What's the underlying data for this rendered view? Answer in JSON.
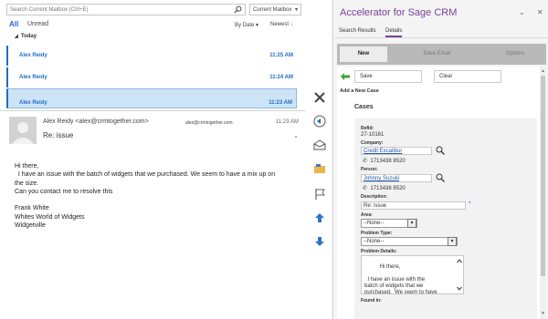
{
  "outlook": {
    "search_placeholder": "Search Current Mailbox (Ctrl+E)",
    "mailbox_scope": "Current Mailbox",
    "filter_all": "All",
    "filter_unread": "Unread",
    "sort_by": "By Date",
    "sort_order": "Newest",
    "group_today": "Today",
    "messages": [
      {
        "from": "Alex Reidy",
        "time": "11:25 AM"
      },
      {
        "from": "Alex Reidy",
        "time": "11:24 AM"
      },
      {
        "from": "Alex Reidy",
        "time": "11:23 AM"
      }
    ],
    "reading": {
      "sender": "Alex Reidy <alex@crmtogether.com>",
      "sender_email": "alex@crmtogether.com",
      "time": "11:23 AM",
      "subject": "Re: issue",
      "body_lines": [
        "Hi there,",
        "  I have an issue with the batch of widgets that we purchased. We seem to have a mix up on",
        "the size.",
        "Can you contact me to resolve this",
        "",
        "Frank White",
        "Whites World of Widgets",
        "Widgetville"
      ]
    }
  },
  "sage": {
    "title": "Accelerator for Sage CRM",
    "tabs": [
      "Search Results",
      "Details"
    ],
    "toolbar": {
      "new": "New",
      "save_email": "Save Email",
      "options": "Options"
    },
    "buttons": {
      "save": "Save",
      "clear": "Clear"
    },
    "add_new": "Add a New Case",
    "section": "Cases",
    "form": {
      "refid_label": "RefId:",
      "refid_value": "27-10161",
      "company_label": "Company:",
      "company_value": "Credit Excalibur",
      "company_phone": "1713438 8520",
      "person_label": "Person:",
      "person_value": "Johnny Suzuki",
      "person_phone": "1713438 8520",
      "description_label": "Description:",
      "description_value": "Re: issue",
      "area_label": "Area:",
      "area_value": "--None--",
      "problem_type_label": "Problem Type:",
      "problem_type_value": "--None--",
      "problem_details_label": "Problem Details:",
      "problem_details_value": "Hi there,\n\n  I have an issue with the\nbatch of widgets that we\npurchased.  We seem to have",
      "found_in_label": "Found in:"
    },
    "colors": {
      "accent": "#7a3f98",
      "link": "#1e56a8",
      "outlook_blue": "#1e6bc4"
    }
  },
  "icons": [
    "search-icon",
    "delete-icon",
    "reply-icon",
    "mark-read-icon",
    "move-icon",
    "flag-icon",
    "up-arrow-icon",
    "down-arrow-icon",
    "back-arrow-icon",
    "magnifier-icon"
  ]
}
